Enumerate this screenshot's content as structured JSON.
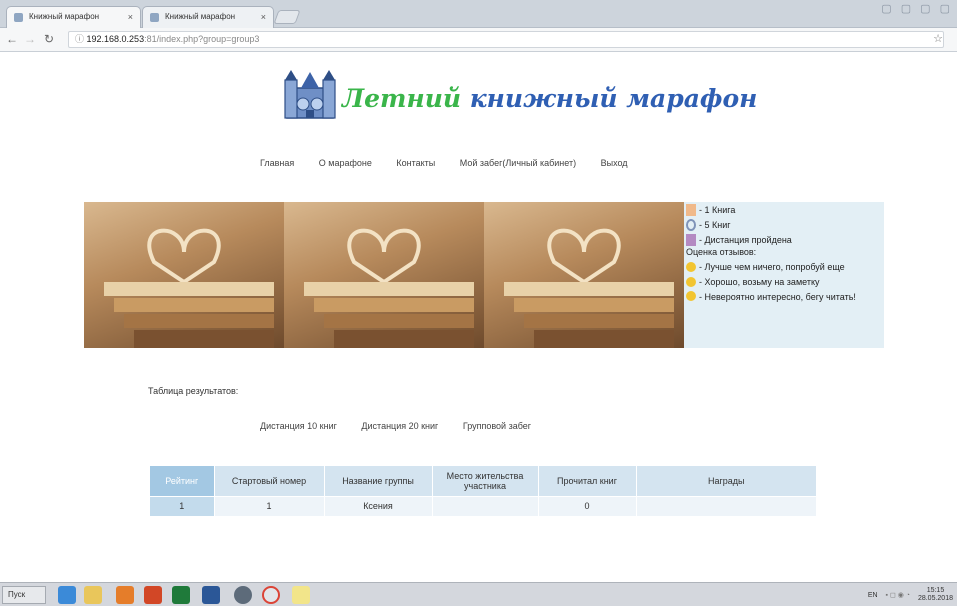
{
  "browser": {
    "tabs": [
      {
        "title": "Книжный марафон",
        "close": "×"
      },
      {
        "title": "Книжный марафон",
        "close": "×"
      }
    ],
    "url_host": "192.168.0.253",
    "url_path": ":81/index.php?group=group3",
    "window_controls": "▢ ▢ ▢ ▢"
  },
  "site": {
    "title_part1": "Летний",
    "title_part2": "книжный марафон",
    "nav": [
      "Главная",
      "О марафоне",
      "Контакты",
      "Мой забег(Личный кабинет)",
      "Выход"
    ]
  },
  "legend": {
    "items": [
      {
        "icon": "book-icon",
        "text": "- 1 Книга",
        "color": "#f0b98a"
      },
      {
        "icon": "medal-icon",
        "text": "- 5 Книг",
        "color": "#7f93b8"
      },
      {
        "icon": "trophy-icon",
        "text": "- Дистанция пройдена",
        "color": "#b48ac2"
      }
    ],
    "review_heading": "Оценка отзывов:",
    "reviews": [
      {
        "icon": "smiley-meh-icon",
        "text": "- Лучше чем ничего, попробуй еще",
        "color": "#f2c531"
      },
      {
        "icon": "smiley-cool-icon",
        "text": "- Хорошо, возьму на заметку",
        "color": "#f2c531"
      },
      {
        "icon": "smiley-happy-icon",
        "text": "- Невероятно интересно, бегу читать!",
        "color": "#f2c531"
      }
    ]
  },
  "results": {
    "title": "Таблица результатов:",
    "tabs": [
      "Дистанция 10 книг",
      "Дистанция 20 книг",
      "Групповой забег"
    ],
    "columns": [
      "Рейтинг",
      "Стартовый номер",
      "Название группы",
      "Место жительства участника",
      "Прочитал книг",
      "Награды"
    ],
    "rows": [
      [
        "1",
        "1",
        "Ксения",
        "",
        "0",
        ""
      ]
    ]
  },
  "taskbar": {
    "start_label": "Пуск",
    "tray_lang": "EN",
    "clock_time": "15:15",
    "clock_date": "28.05.2018"
  },
  "colors": {
    "accent_green": "#3ab54a",
    "accent_blue": "#2f5fb3",
    "table_header": "#d4e4f0",
    "legend_bg": "#e3eff5"
  }
}
